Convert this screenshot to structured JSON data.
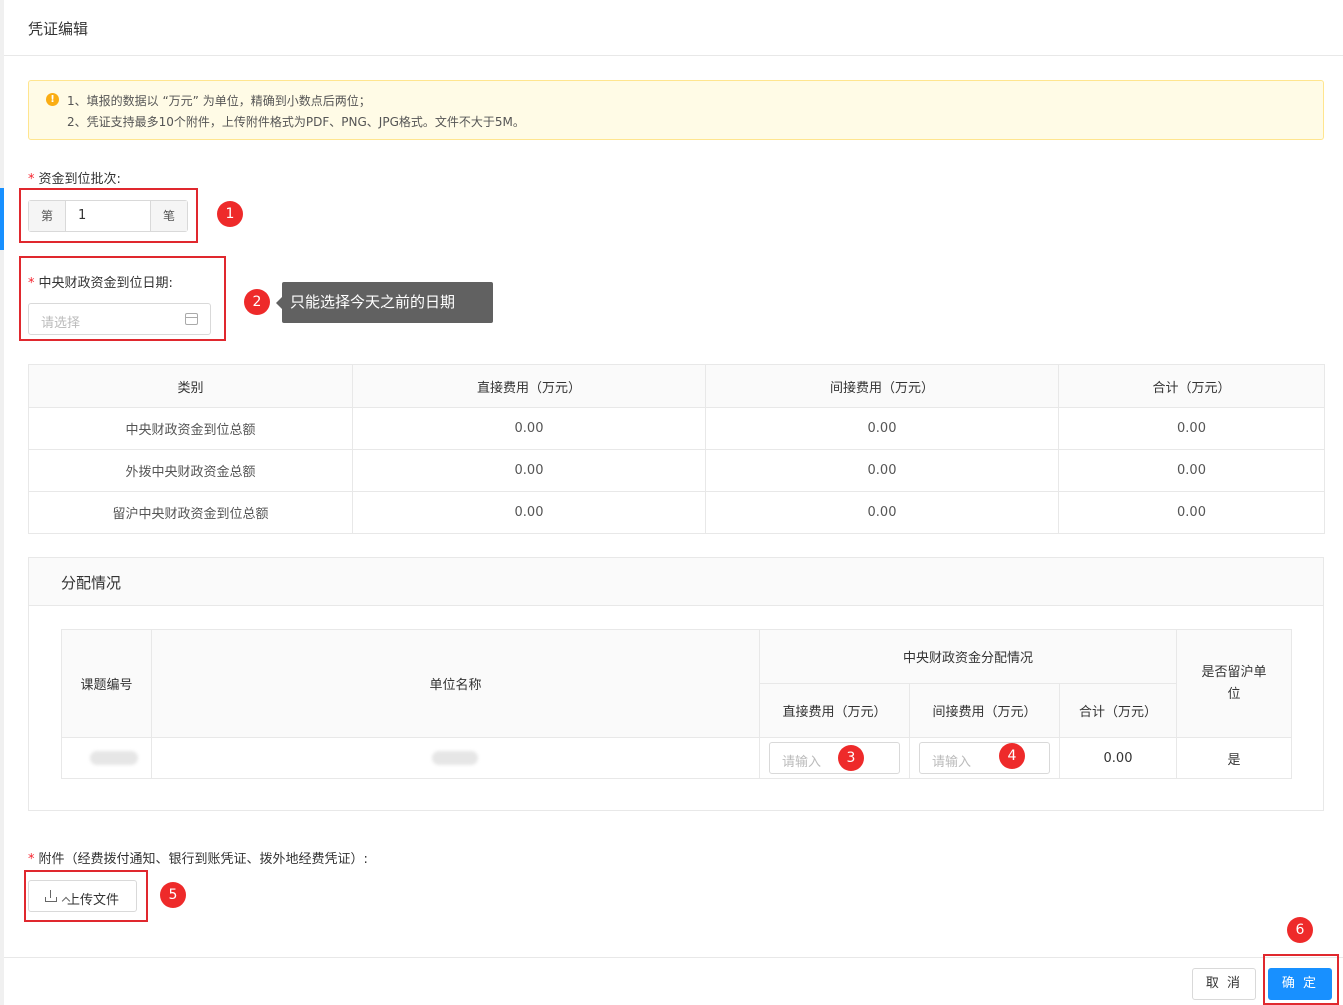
{
  "dialog": {
    "title": "凭证编辑"
  },
  "notice": {
    "line1": "1、填报的数据以 “万元” 为单位，精确到小数点后两位；",
    "line2": "2、凭证支持最多10个附件，上传附件格式为PDF、PNG、JPG格式。文件不大于5M。",
    "icon": "warning-icon"
  },
  "batch": {
    "label": "资金到位批次:",
    "prefix": "第",
    "value": "1",
    "suffix": "笔",
    "required_mark": "*"
  },
  "date": {
    "label": "中央财政资金到位日期:",
    "placeholder": "请选择",
    "required_mark": "*",
    "icon": "calendar-icon"
  },
  "tooltip": {
    "text": "只能选择今天之前的日期"
  },
  "badges": [
    "1",
    "2",
    "3",
    "4",
    "5",
    "6"
  ],
  "summary_table": {
    "headers": [
      "类别",
      "直接费用（万元）",
      "间接费用（万元）",
      "合计（万元）"
    ],
    "rows": [
      [
        "中央财政资金到位总额",
        "0.00",
        "0.00",
        "0.00"
      ],
      [
        "外拨中央财政资金总额",
        "0.00",
        "0.00",
        "0.00"
      ],
      [
        "留沪中央财政资金到位总额",
        "0.00",
        "0.00",
        "0.00"
      ]
    ]
  },
  "allocation": {
    "title": "分配情况",
    "headers": {
      "project_no": "课题编号",
      "unit_name": "单位名称",
      "group": "中央财政资金分配情况",
      "direct": "直接费用（万元）",
      "indirect": "间接费用（万元）",
      "total": "合计（万元）",
      "retain": "是否留沪单位"
    },
    "row": {
      "direct_placeholder": "请输入",
      "indirect_placeholder": "请输入",
      "total": "0.00",
      "retain": "是"
    }
  },
  "attachment": {
    "label": "附件（经费拨付通知、银行到账凭证、拨外地经费凭证）:",
    "required_mark": "*",
    "upload_label": "上传文件",
    "icon": "upload-icon"
  },
  "footer": {
    "cancel": "取 消",
    "ok": "确 定"
  },
  "colors": {
    "primary": "#1890ff",
    "annotation": "#e0282e",
    "alert_bg": "#fffbe6"
  }
}
